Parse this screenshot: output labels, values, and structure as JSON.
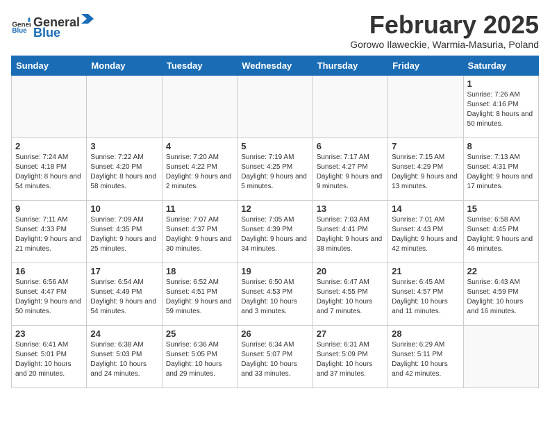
{
  "logo": {
    "general": "General",
    "blue": "Blue"
  },
  "title": "February 2025",
  "subtitle": "Gorowo Ilaweckie, Warmia-Masuria, Poland",
  "weekdays": [
    "Sunday",
    "Monday",
    "Tuesday",
    "Wednesday",
    "Thursday",
    "Friday",
    "Saturday"
  ],
  "weeks": [
    [
      {
        "day": "",
        "info": ""
      },
      {
        "day": "",
        "info": ""
      },
      {
        "day": "",
        "info": ""
      },
      {
        "day": "",
        "info": ""
      },
      {
        "day": "",
        "info": ""
      },
      {
        "day": "",
        "info": ""
      },
      {
        "day": "1",
        "info": "Sunrise: 7:26 AM\nSunset: 4:16 PM\nDaylight: 8 hours and 50 minutes."
      }
    ],
    [
      {
        "day": "2",
        "info": "Sunrise: 7:24 AM\nSunset: 4:18 PM\nDaylight: 8 hours and 54 minutes."
      },
      {
        "day": "3",
        "info": "Sunrise: 7:22 AM\nSunset: 4:20 PM\nDaylight: 8 hours and 58 minutes."
      },
      {
        "day": "4",
        "info": "Sunrise: 7:20 AM\nSunset: 4:22 PM\nDaylight: 9 hours and 2 minutes."
      },
      {
        "day": "5",
        "info": "Sunrise: 7:19 AM\nSunset: 4:25 PM\nDaylight: 9 hours and 5 minutes."
      },
      {
        "day": "6",
        "info": "Sunrise: 7:17 AM\nSunset: 4:27 PM\nDaylight: 9 hours and 9 minutes."
      },
      {
        "day": "7",
        "info": "Sunrise: 7:15 AM\nSunset: 4:29 PM\nDaylight: 9 hours and 13 minutes."
      },
      {
        "day": "8",
        "info": "Sunrise: 7:13 AM\nSunset: 4:31 PM\nDaylight: 9 hours and 17 minutes."
      }
    ],
    [
      {
        "day": "9",
        "info": "Sunrise: 7:11 AM\nSunset: 4:33 PM\nDaylight: 9 hours and 21 minutes."
      },
      {
        "day": "10",
        "info": "Sunrise: 7:09 AM\nSunset: 4:35 PM\nDaylight: 9 hours and 25 minutes."
      },
      {
        "day": "11",
        "info": "Sunrise: 7:07 AM\nSunset: 4:37 PM\nDaylight: 9 hours and 30 minutes."
      },
      {
        "day": "12",
        "info": "Sunrise: 7:05 AM\nSunset: 4:39 PM\nDaylight: 9 hours and 34 minutes."
      },
      {
        "day": "13",
        "info": "Sunrise: 7:03 AM\nSunset: 4:41 PM\nDaylight: 9 hours and 38 minutes."
      },
      {
        "day": "14",
        "info": "Sunrise: 7:01 AM\nSunset: 4:43 PM\nDaylight: 9 hours and 42 minutes."
      },
      {
        "day": "15",
        "info": "Sunrise: 6:58 AM\nSunset: 4:45 PM\nDaylight: 9 hours and 46 minutes."
      }
    ],
    [
      {
        "day": "16",
        "info": "Sunrise: 6:56 AM\nSunset: 4:47 PM\nDaylight: 9 hours and 50 minutes."
      },
      {
        "day": "17",
        "info": "Sunrise: 6:54 AM\nSunset: 4:49 PM\nDaylight: 9 hours and 54 minutes."
      },
      {
        "day": "18",
        "info": "Sunrise: 6:52 AM\nSunset: 4:51 PM\nDaylight: 9 hours and 59 minutes."
      },
      {
        "day": "19",
        "info": "Sunrise: 6:50 AM\nSunset: 4:53 PM\nDaylight: 10 hours and 3 minutes."
      },
      {
        "day": "20",
        "info": "Sunrise: 6:47 AM\nSunset: 4:55 PM\nDaylight: 10 hours and 7 minutes."
      },
      {
        "day": "21",
        "info": "Sunrise: 6:45 AM\nSunset: 4:57 PM\nDaylight: 10 hours and 11 minutes."
      },
      {
        "day": "22",
        "info": "Sunrise: 6:43 AM\nSunset: 4:59 PM\nDaylight: 10 hours and 16 minutes."
      }
    ],
    [
      {
        "day": "23",
        "info": "Sunrise: 6:41 AM\nSunset: 5:01 PM\nDaylight: 10 hours and 20 minutes."
      },
      {
        "day": "24",
        "info": "Sunrise: 6:38 AM\nSunset: 5:03 PM\nDaylight: 10 hours and 24 minutes."
      },
      {
        "day": "25",
        "info": "Sunrise: 6:36 AM\nSunset: 5:05 PM\nDaylight: 10 hours and 29 minutes."
      },
      {
        "day": "26",
        "info": "Sunrise: 6:34 AM\nSunset: 5:07 PM\nDaylight: 10 hours and 33 minutes."
      },
      {
        "day": "27",
        "info": "Sunrise: 6:31 AM\nSunset: 5:09 PM\nDaylight: 10 hours and 37 minutes."
      },
      {
        "day": "28",
        "info": "Sunrise: 6:29 AM\nSunset: 5:11 PM\nDaylight: 10 hours and 42 minutes."
      },
      {
        "day": "",
        "info": ""
      }
    ]
  ]
}
